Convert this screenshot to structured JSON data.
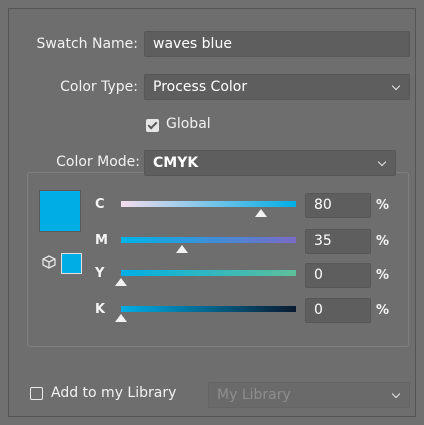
{
  "swatch_name": {
    "label": "Swatch Name:",
    "value": "waves blue"
  },
  "color_type": {
    "label": "Color Type:",
    "value": "Process Color"
  },
  "global": {
    "label": "Global",
    "checked": true
  },
  "color_mode": {
    "label": "Color Mode:",
    "value": "CMYK"
  },
  "swatch_color": "#00aee6",
  "channels": [
    {
      "label": "C",
      "value": "80",
      "unit": "%",
      "fraction": 0.8
    },
    {
      "label": "M",
      "value": "35",
      "unit": "%",
      "fraction": 0.35
    },
    {
      "label": "Y",
      "value": "0",
      "unit": "%",
      "fraction": 0.0
    },
    {
      "label": "K",
      "value": "0",
      "unit": "%",
      "fraction": 0.0
    }
  ],
  "icons": {
    "out_of_gamut": "cube-icon"
  },
  "library": {
    "label": "Add to my Library",
    "checked": false,
    "select_value": "My Library"
  }
}
